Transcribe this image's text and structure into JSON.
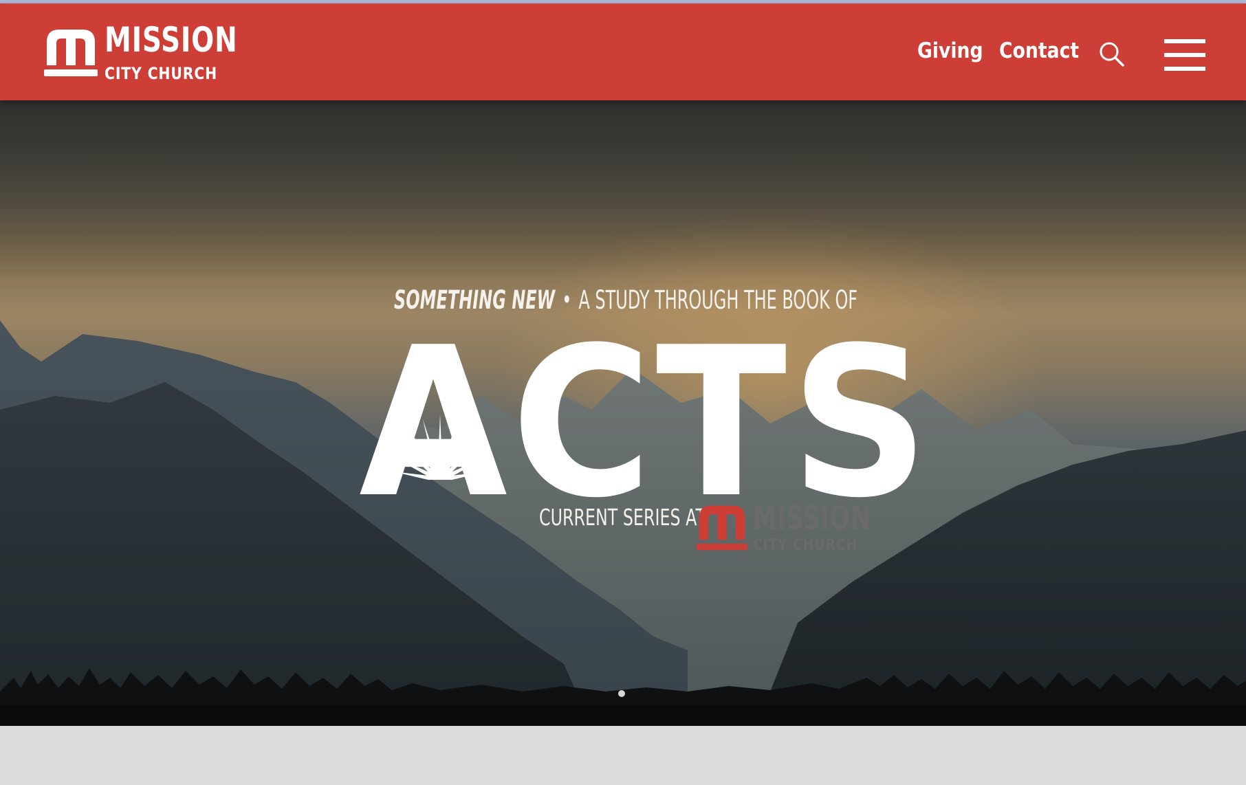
{
  "header": {
    "logo": {
      "word": "MISSION",
      "sub": "CITY CHURCH"
    },
    "nav": {
      "giving": "Giving",
      "contact": "Contact"
    },
    "icons": {
      "search": "search-icon",
      "menu": "hamburger-menu-icon"
    },
    "colors": {
      "header_bg": "#cd3e36",
      "text": "#ffffff"
    }
  },
  "hero": {
    "kicker_emphasis": "SOMETHING NEW",
    "kicker_separator": "•",
    "kicker_rest": "A STUDY THROUGH THE BOOK OF",
    "title": "ACTS",
    "series_label": "CURRENT SERIES AT:",
    "logo": {
      "word": "MISSION",
      "sub": "CITY CHURCH",
      "mark_color": "#cd3e36",
      "text_color": "#6b6b6b"
    },
    "slider": {
      "total_slides": 1,
      "active_slide": 1
    }
  },
  "page": {
    "below_hero_bg": "#dcdcda"
  }
}
